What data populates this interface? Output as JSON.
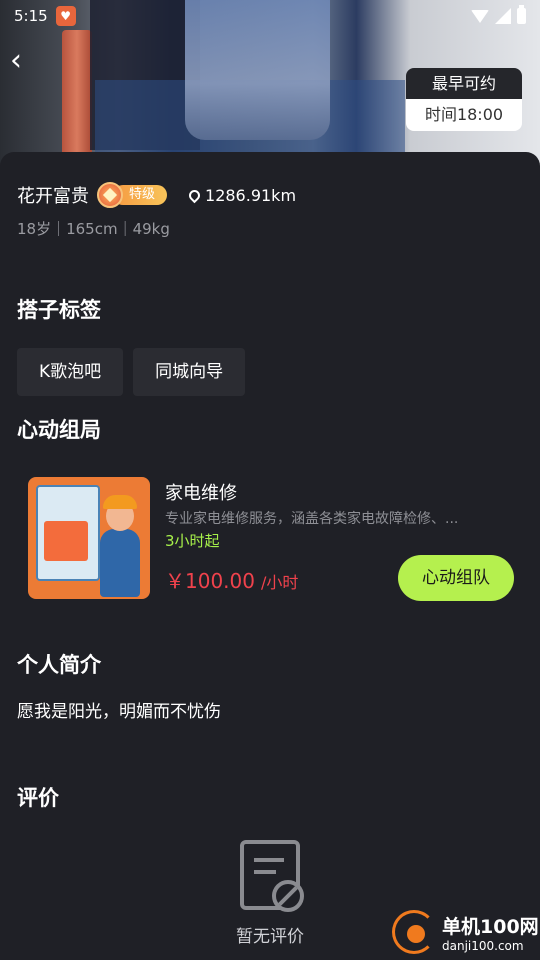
{
  "status_bar": {
    "time": "5:15"
  },
  "availability": {
    "title": "最早可约",
    "time": "时间18:00"
  },
  "profile": {
    "name": "花开富贵",
    "level": "特级",
    "distance": "1286.91km",
    "meta": "18岁｜165cm｜49kg"
  },
  "sections": {
    "tags_title": "搭子标签",
    "events_title": "心动组局",
    "bio_title": "个人简介",
    "reviews_title": "评价"
  },
  "tags": [
    "K歌泡吧",
    "同城向导"
  ],
  "service": {
    "name": "家电维修",
    "description": "专业家电维修服务，涵盖各类家电故障检修、...",
    "min_duration": "3小时起",
    "price": "￥100.00",
    "unit": "/小时",
    "join_label": "心动组队"
  },
  "bio": "愿我是阳光，明媚而不忧伤",
  "reviews": {
    "empty_text": "暂无评价"
  },
  "watermark": {
    "title": "单机100网",
    "subtitle": "danji100.com"
  },
  "colors": {
    "accent_green": "#b5f04e",
    "price_red": "#f0424c",
    "background": "#1f2026"
  }
}
